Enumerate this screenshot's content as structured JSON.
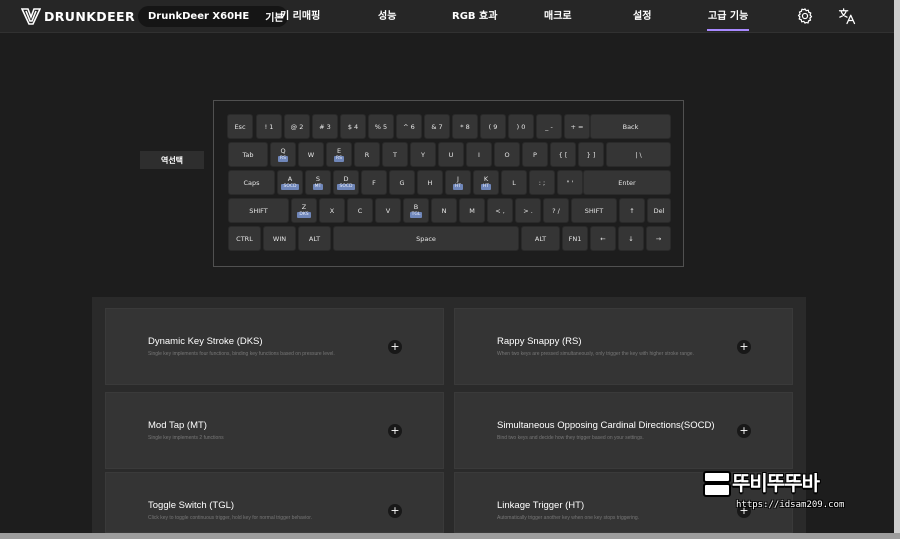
{
  "nav": {
    "logo_text": "DRUNKDEER",
    "device": "DrunkDeer X60HE",
    "mode": "기본 모드",
    "items": [
      {
        "label": "키 리매핑",
        "active": false
      },
      {
        "label": "성능",
        "active": false
      },
      {
        "label": "RGB 효과",
        "active": false
      },
      {
        "label": "매크로",
        "active": false
      },
      {
        "label": "설정",
        "active": false
      },
      {
        "label": "고급 기능",
        "active": true
      }
    ],
    "icons": [
      "gear-icon",
      "translate-icon"
    ],
    "accent_color": "#a889ff"
  },
  "selector": {
    "label": "역선택"
  },
  "keyboard": {
    "rows": [
      [
        {
          "label": "Esc"
        },
        {
          "label": "! 1"
        },
        {
          "label": "@ 2"
        },
        {
          "label": "# 3"
        },
        {
          "label": "$ 4"
        },
        {
          "label": "% 5"
        },
        {
          "label": "^ 6"
        },
        {
          "label": "& 7"
        },
        {
          "label": "* 8"
        },
        {
          "label": "( 9"
        },
        {
          "label": ") 0"
        },
        {
          "label": "_ -"
        },
        {
          "label": "+ ="
        },
        {
          "label": "Back"
        }
      ],
      [
        {
          "label": "Tab"
        },
        {
          "label": "Q",
          "tag": "RS"
        },
        {
          "label": "W"
        },
        {
          "label": "E",
          "tag": "RS"
        },
        {
          "label": "R"
        },
        {
          "label": "T"
        },
        {
          "label": "Y"
        },
        {
          "label": "U"
        },
        {
          "label": "I"
        },
        {
          "label": "O"
        },
        {
          "label": "P"
        },
        {
          "label": "{ ["
        },
        {
          "label": "} ]"
        },
        {
          "label": "| \\"
        }
      ],
      [
        {
          "label": "Caps"
        },
        {
          "label": "A",
          "tag": "SOCD"
        },
        {
          "label": "S",
          "tag": "MT"
        },
        {
          "label": "D",
          "tag": "SOCD"
        },
        {
          "label": "F"
        },
        {
          "label": "G"
        },
        {
          "label": "H"
        },
        {
          "label": "J",
          "tag": "HT"
        },
        {
          "label": "K",
          "tag": "HT"
        },
        {
          "label": "L"
        },
        {
          "label": ": ;"
        },
        {
          "label": "\" '"
        },
        {
          "label": "Enter"
        }
      ],
      [
        {
          "label": "SHIFT"
        },
        {
          "label": "Z",
          "tag": "DKS"
        },
        {
          "label": "X"
        },
        {
          "label": "C"
        },
        {
          "label": "V"
        },
        {
          "label": "B",
          "tag": "TGL"
        },
        {
          "label": "N"
        },
        {
          "label": "M"
        },
        {
          "label": "< ,"
        },
        {
          "label": "> ."
        },
        {
          "label": "? /"
        },
        {
          "label": "SHIFT"
        },
        {
          "label": "↑"
        },
        {
          "label": "Del"
        }
      ],
      [
        {
          "label": "CTRL"
        },
        {
          "label": "WIN"
        },
        {
          "label": "ALT"
        },
        {
          "label": "Space"
        },
        {
          "label": "ALT"
        },
        {
          "label": "FN1"
        },
        {
          "label": "←"
        },
        {
          "label": "↓"
        },
        {
          "label": "→"
        }
      ]
    ]
  },
  "features": [
    {
      "title": "Dynamic Key Stroke (DKS)",
      "desc": "Single key implements four functions, binding key functions based on pressure level."
    },
    {
      "title": "Rappy Snappy (RS)",
      "desc": "When two keys are pressed simultaneously, only trigger the key with higher stroke range."
    },
    {
      "title": "Mod Tap (MT)",
      "desc": "Single key implements 2 functions"
    },
    {
      "title": "Simultaneous Opposing Cardinal Directions(SOCD)",
      "desc": "Bind two keys and decide how they trigger based on your settings."
    },
    {
      "title": "Toggle Switch (TGL)",
      "desc": "Click key to toggle continuous trigger, hold key for normal trigger behavior."
    },
    {
      "title": "Linkage Trigger (HT)",
      "desc": "Automatically trigger another key when one key stops triggering."
    }
  ],
  "add_button_label": "+",
  "watermark": {
    "text": "뚜비뚜뚜바",
    "url": "https://idsam209.com"
  }
}
